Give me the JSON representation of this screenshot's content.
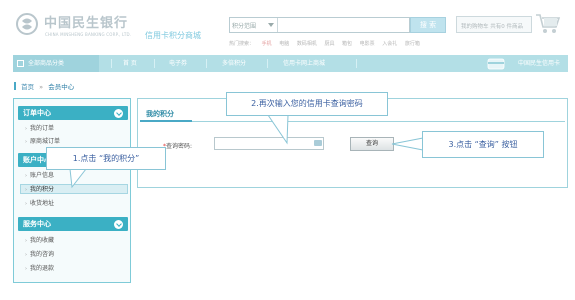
{
  "header": {
    "logo_cn": "中国民生银行",
    "logo_en": "CHINA MINSHENG BANKING CORP., LTD.",
    "logo_sub": "信用卡积分商城",
    "search_select": "积分范围",
    "search_placeholder": "",
    "search_button": "搜 索",
    "hot_label": "热门搜索：",
    "hot_words": [
      "手机",
      "电脑",
      "数码相机",
      "厨具",
      "箱包",
      "电影票",
      "入会礼",
      "旅行箱"
    ],
    "cart_text": "我的购物车  共有0 件商品"
  },
  "navbar": {
    "all_categories": "全部商品分类",
    "items": [
      "首 页",
      "电子券",
      "多倍积分",
      "信用卡网上商城"
    ],
    "right_label": "中国民生信用卡"
  },
  "breadcrumb": {
    "home": "首页",
    "separator": "»",
    "current": "会员中心"
  },
  "sidebar": {
    "sections": [
      {
        "title": "订单中心",
        "items": [
          "我的订单",
          "原商城订单"
        ]
      },
      {
        "title": "账户中心",
        "items": [
          "账户信息",
          "我的积分",
          "收货地址"
        ]
      },
      {
        "title": "服务中心",
        "items": [
          "我的收藏",
          "我的咨询",
          "我的退款"
        ]
      }
    ],
    "active_item": "我的积分"
  },
  "main": {
    "tab_title": "我的积分",
    "password_label": "查询密码:",
    "password_required_mark": "*",
    "password_value": "",
    "query_button": "查询"
  },
  "callouts": {
    "step1": "1.点击 “我的积分”",
    "step2": "2.再次输入您的信用卡查询密码",
    "step3": "3.点击 “查询” 按钮"
  },
  "colors": {
    "accent": "#3bb0c4",
    "nav_bg": "#b3dfe6",
    "callout_text": "#3a5fa0",
    "callout_border": "#89c5d6"
  }
}
